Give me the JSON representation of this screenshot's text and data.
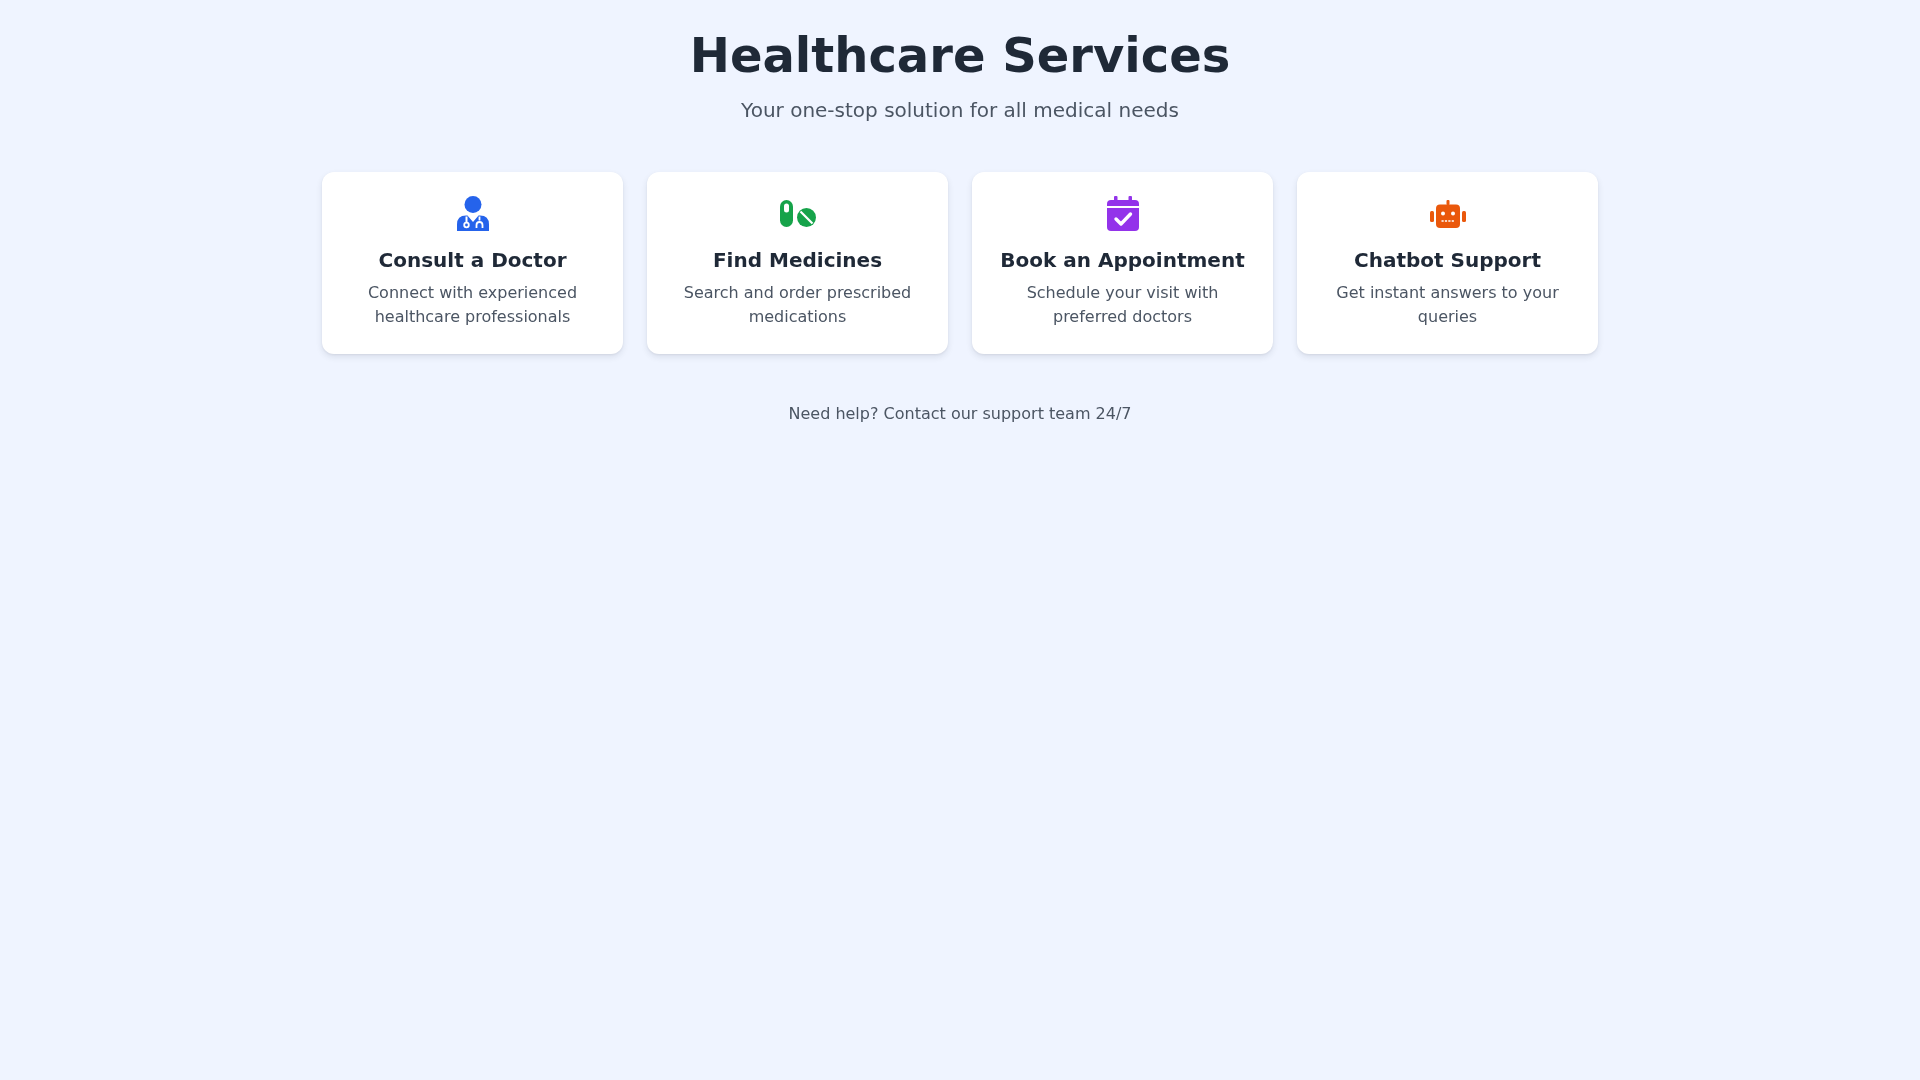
{
  "header": {
    "title": "Healthcare Services",
    "subtitle": "Your one-stop solution for all medical needs"
  },
  "services": [
    {
      "kind": "doctor",
      "color": "#2563eb",
      "title": "Consult a Doctor",
      "description": "Connect with experienced healthcare professionals"
    },
    {
      "kind": "pills",
      "color": "#16a34a",
      "title": "Find Medicines",
      "description": "Search and order prescribed medications"
    },
    {
      "kind": "calendar",
      "color": "#9333ea",
      "title": "Book an Appointment",
      "description": "Schedule your visit with preferred doctors"
    },
    {
      "kind": "robot",
      "color": "#ea580c",
      "title": "Chatbot Support",
      "description": "Get instant answers to your queries"
    }
  ],
  "footer": {
    "text": "Need help? Contact our support team 24/7"
  }
}
